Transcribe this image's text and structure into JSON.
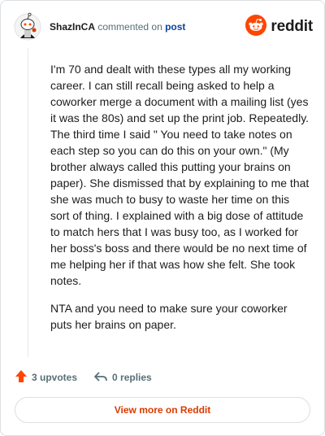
{
  "header": {
    "username": "ShazInCA",
    "action_text": "commented on",
    "post_link": "post",
    "brand": "reddit"
  },
  "comment": {
    "paragraphs": [
      "I'm 70 and dealt with these types all my working career. I can still recall being asked to help a coworker merge a document with a mailing list (yes it was the 80s) and set up the print job. Repeatedly. The third time I said \" You need to take notes on each step so you can do this on your own.\" (My brother always called this putting your brains on paper). She dismissed that by explaining to me that she was much to busy to waste her time on this sort of thing. I explained with a big dose of attitude to match hers that I was busy too, as I worked for her boss's boss and there would be no next time of me helping her if that was how she felt. She took notes.",
      "NTA and you need to make sure your coworker puts her brains on paper."
    ]
  },
  "actions": {
    "upvotes": "3 upvotes",
    "replies": "0 replies"
  },
  "footer": {
    "view_more": "View more on Reddit"
  },
  "colors": {
    "upvote": "#ff4500",
    "link": "#0a449b",
    "view_more": "#d93a00"
  },
  "icons": {
    "avatar": "snoo-avatar-icon",
    "brand": "reddit-logo-icon",
    "upvote": "upvote-arrow-icon",
    "reply": "reply-arrow-icon"
  }
}
